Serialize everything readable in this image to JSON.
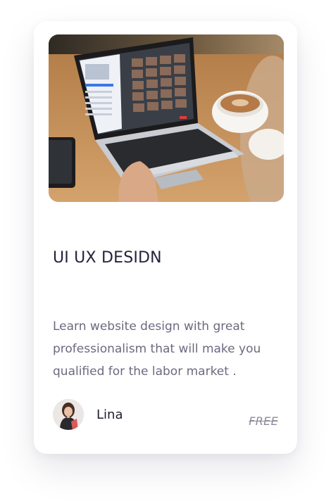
{
  "course": {
    "title": "UI UX DESIDN",
    "description": "Learn website design with great professionalism that will make you qualified for the labor market .",
    "price": "FREE"
  },
  "author": {
    "name": "Lina"
  },
  "colors": {
    "title": "#23233d",
    "description": "#6b6a80",
    "price": "#8b8a99"
  }
}
